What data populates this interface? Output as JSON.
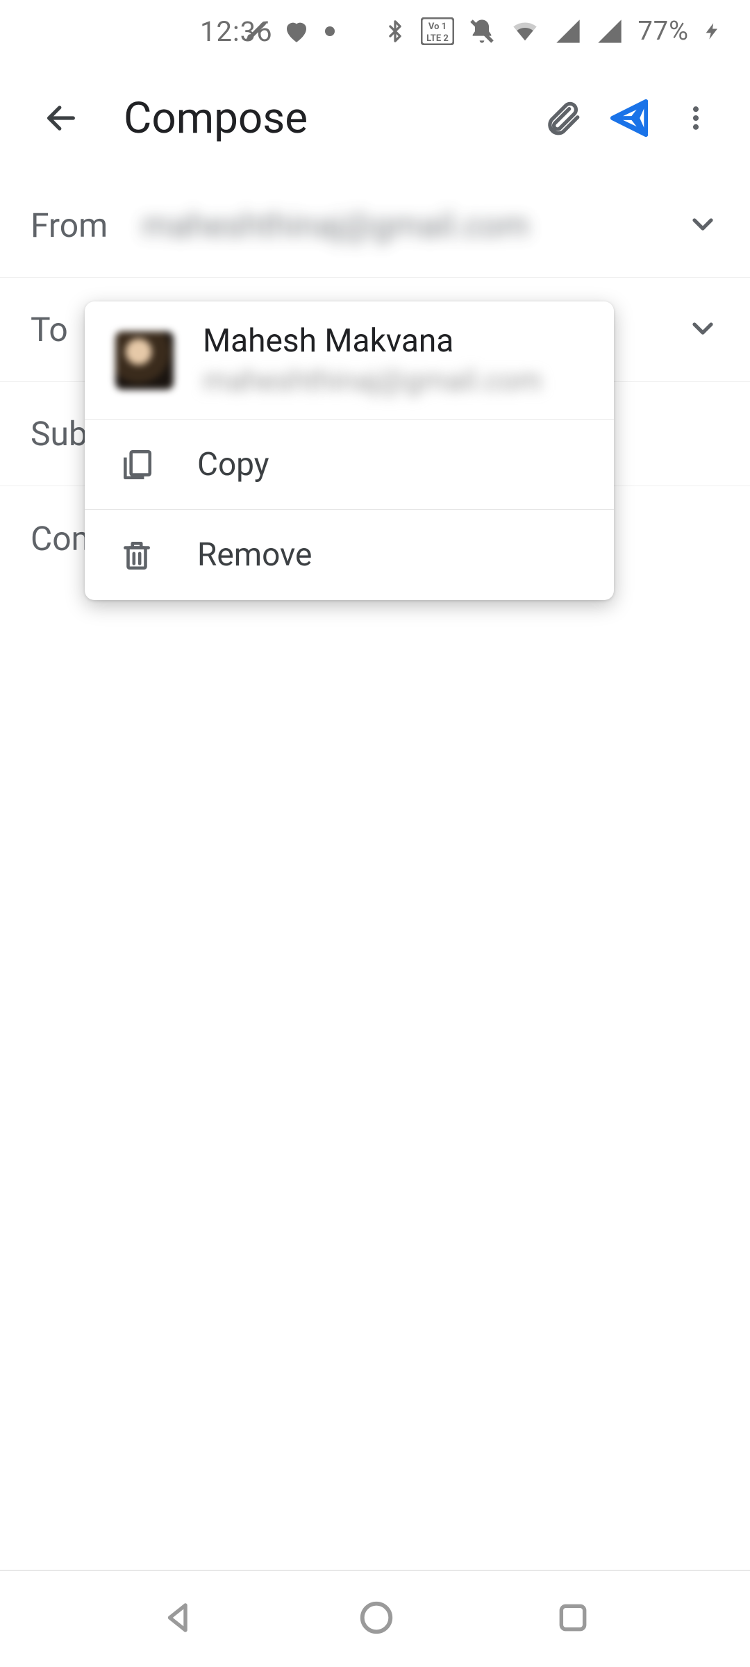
{
  "status_bar": {
    "time": "12:36",
    "battery_percent": "77%"
  },
  "app_bar": {
    "title": "Compose"
  },
  "fields": {
    "from_label": "From",
    "from_value": "maheshthinaj@gmail.com",
    "to_label": "To",
    "subject_label": "Subject",
    "body_placeholder": "Compose email"
  },
  "popup": {
    "contact": {
      "name": "Mahesh Makvana",
      "email": "maheshthinaj@gmail.com"
    },
    "copy_label": "Copy",
    "remove_label": "Remove"
  }
}
